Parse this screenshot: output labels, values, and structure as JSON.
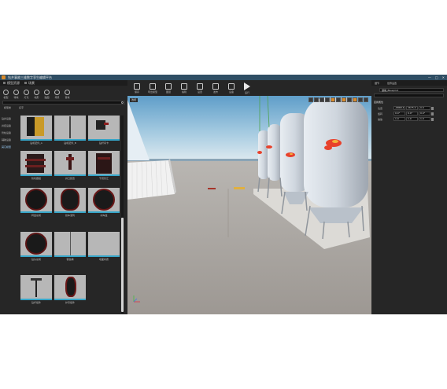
{
  "window": {
    "title": "钻井事故三维数字孪生编辑平台",
    "controls": [
      "—",
      "□",
      "✕"
    ]
  },
  "left_panel": {
    "tabs": [
      {
        "label": "模型资源"
      },
      {
        "label": "场景"
      }
    ],
    "tools": [
      {
        "label": "模型"
      },
      {
        "label": "特效"
      },
      {
        "label": "灯光"
      },
      {
        "label": "地形"
      },
      {
        "label": "贴图"
      },
      {
        "label": "场景"
      },
      {
        "label": "音效"
      }
    ],
    "search_placeholder": "",
    "headers": [
      "模型类",
      "名字"
    ],
    "categories": [
      {
        "label": "钻井设备"
      },
      {
        "label": "井控设备"
      },
      {
        "label": "管柱设备"
      },
      {
        "label": "辅助设备"
      },
      {
        "label": "其它模型"
      }
    ],
    "active_category": 4,
    "thumbs": [
      {
        "label": "钻机配件_A"
      },
      {
        "label": "钻机配件_B"
      },
      {
        "label": "钻杆吊卡"
      },
      {
        "label": "防喷器组"
      },
      {
        "label": "井口装置"
      },
      {
        "label": "节流管汇"
      },
      {
        "label": "转盘总成"
      },
      {
        "label": "绞车滚筒"
      },
      {
        "label": "刹车盘"
      },
      {
        "label": "钻头总成"
      },
      {
        "label": "钢丝绳"
      },
      {
        "label": "地面材质"
      },
      {
        "label": "钻杆组件"
      },
      {
        "label": "护罩组件"
      }
    ]
  },
  "toolbar": [
    {
      "label": "保存"
    },
    {
      "label": "导出模型"
    },
    {
      "label": "图层"
    },
    {
      "label": "编辑"
    },
    {
      "label": "设置"
    },
    {
      "label": "发布"
    },
    {
      "label": "设备"
    },
    {
      "label": "运行"
    }
  ],
  "viewport": {
    "mode_label": "透视"
  },
  "right_panel": {
    "tabs": [
      "细节",
      "世界设置"
    ],
    "object_name": "储罐_Blueprint",
    "section": "变换属性",
    "rows": [
      {
        "label": "位置",
        "values": [
          "-6868.4",
          "2675.0",
          "0.0"
        ]
      },
      {
        "label": "旋转",
        "values": [
          "0.0°",
          "0.0°",
          "0.0°"
        ]
      },
      {
        "label": "缩放",
        "values": [
          "1.0",
          "1.0",
          "1.0"
        ]
      }
    ]
  },
  "colors": {
    "accent": "#d98b2b",
    "thumb_bar": "#35a5c8",
    "titlebar": "#2f4e64",
    "tank_flame": "#e8412b"
  }
}
